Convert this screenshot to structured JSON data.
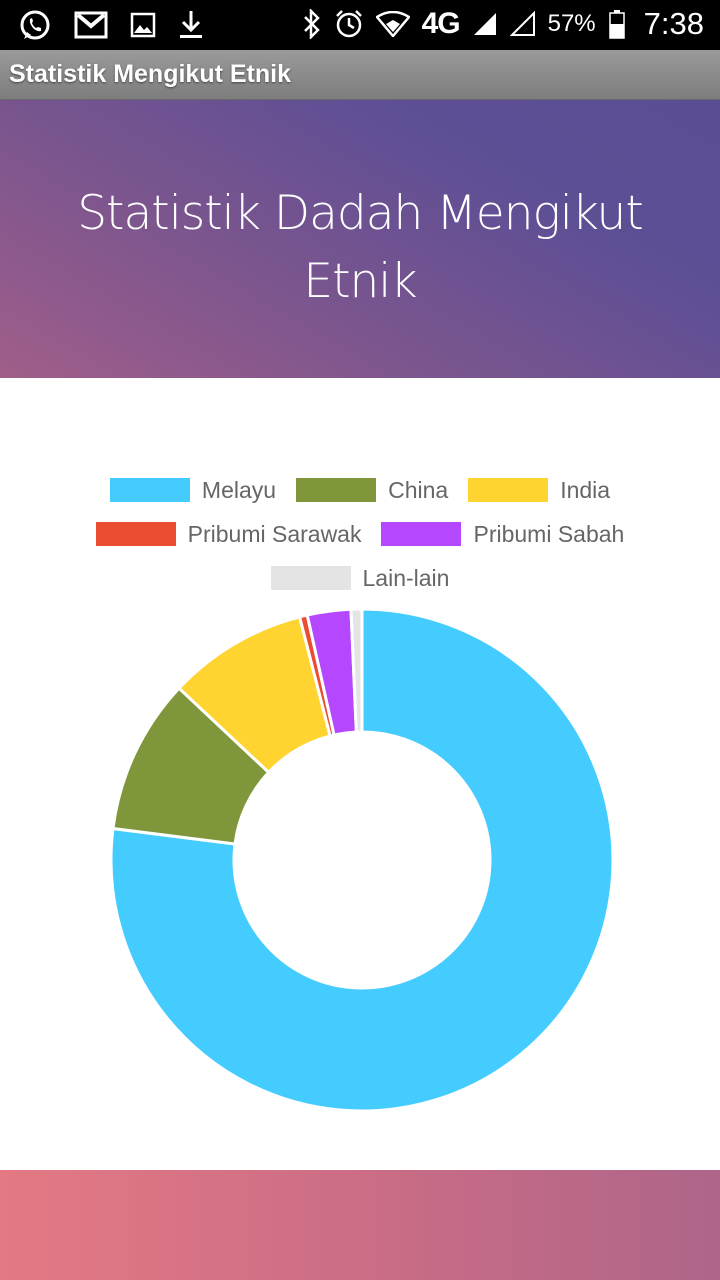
{
  "status_bar": {
    "icons_left": [
      "whatsapp-icon",
      "gmail-icon",
      "gallery-icon",
      "download-icon"
    ],
    "icons_right": [
      "bluetooth-icon",
      "alarm-icon",
      "wifi-icon",
      "signal-icon",
      "signal-empty-icon",
      "battery-icon"
    ],
    "network": "4G",
    "battery": "57%",
    "time": "7:38"
  },
  "action_bar": {
    "title": "Statistik Mengikut Etnik"
  },
  "hero": {
    "title": "Statistik Dadah Mengikut Etnik"
  },
  "chart_data": {
    "type": "pie",
    "donut": true,
    "legend_position": "top",
    "categories": [
      "Melayu",
      "China",
      "India",
      "Pribumi Sarawak",
      "Pribumi Sabah",
      "Lain-lain"
    ],
    "values": [
      77.0,
      10.0,
      9.0,
      0.5,
      2.8,
      0.7
    ],
    "colors": [
      "#45CCFF",
      "#80963A",
      "#FFD430",
      "#EB4D33",
      "#B547FF",
      "#E4E4E4"
    ]
  }
}
